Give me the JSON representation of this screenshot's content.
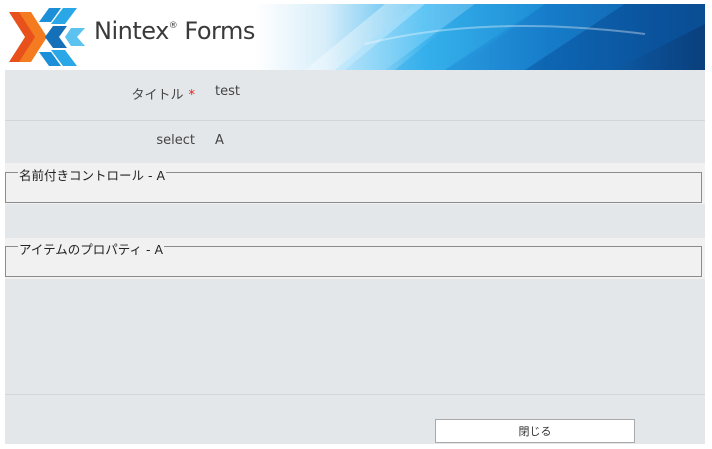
{
  "header": {
    "logo_text": "Nintex",
    "logo_reg": "®",
    "logo_product": " Forms",
    "logo_icon": "nintex-x-logo-icon"
  },
  "form": {
    "fields": [
      {
        "label": "タイトル",
        "required_mark": "*",
        "value": "test"
      },
      {
        "label": "select",
        "value": "A"
      }
    ],
    "groups": [
      {
        "legend": "名前付きコントロール - A"
      },
      {
        "legend": "アイテムのプロパティ - A"
      }
    ]
  },
  "footer": {
    "close_label": "閉じる"
  },
  "colors": {
    "accent_blue": "#1377c4",
    "logo_orange": "#e8501c",
    "required_red": "#e02020",
    "form_background": "#e4e7ea"
  }
}
